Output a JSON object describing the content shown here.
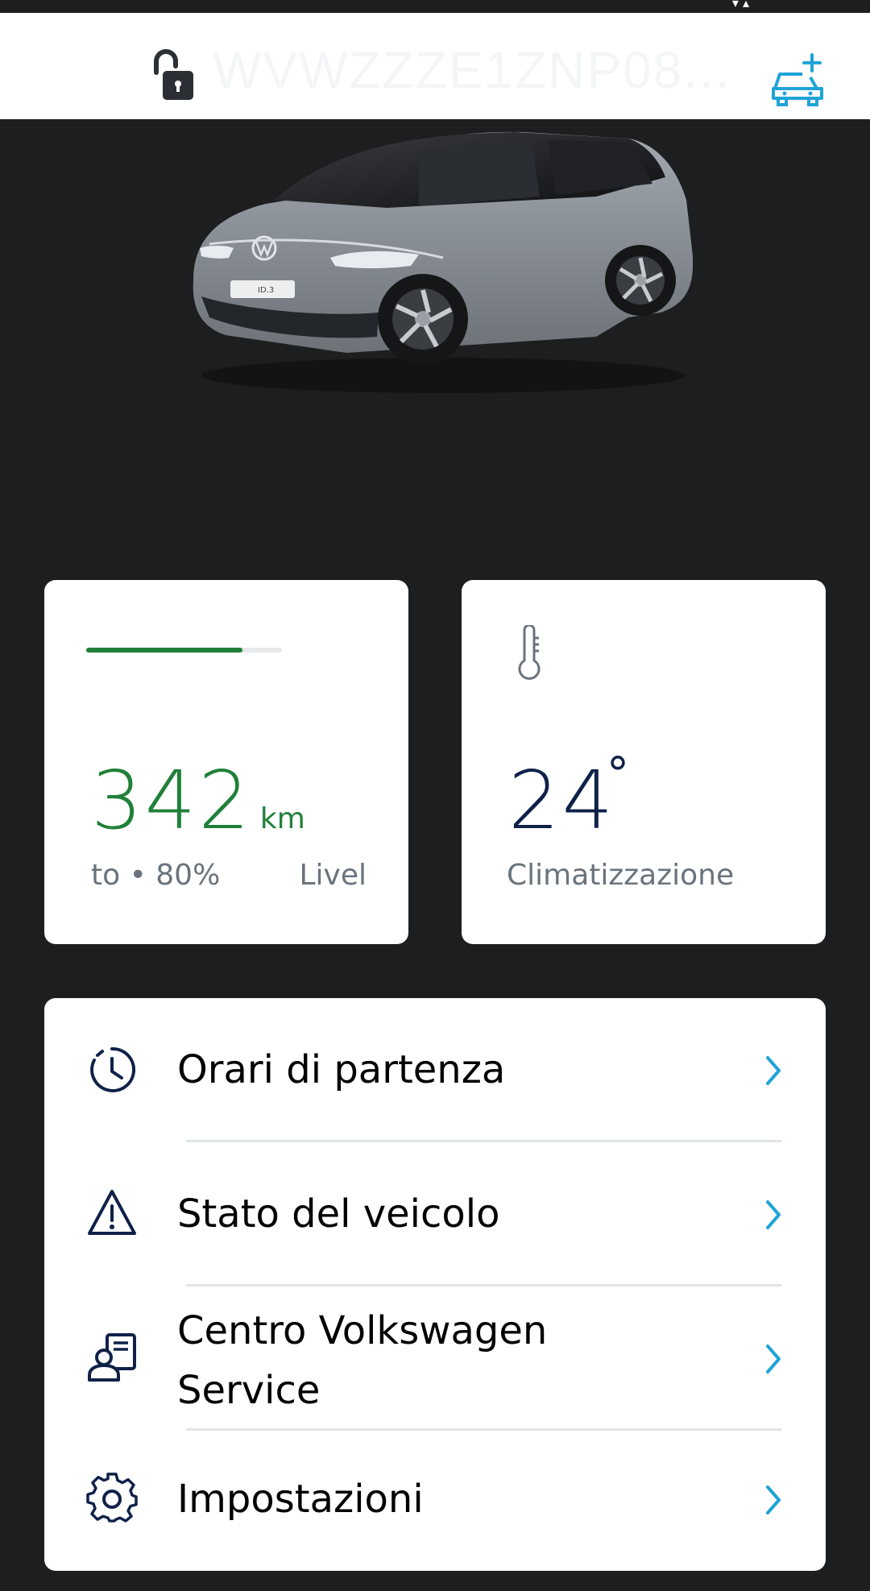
{
  "header": {
    "vin": "WVWZZZE1ZNP08..."
  },
  "colors": {
    "accent": "#1fa3d8",
    "range_green": "#208039",
    "navy": "#0f2149",
    "muted_text": "#6a737d",
    "background": "#1d1e20"
  },
  "icons": {
    "lock": "lock-open-icon",
    "add_vehicle": "add-vehicle-icon",
    "thermometer": "thermometer-icon",
    "clock": "clock-icon",
    "warning": "warning-icon",
    "service": "service-icon",
    "gear": "gear-icon",
    "chevron": "chevron-right-icon"
  },
  "range_card": {
    "value": "342",
    "unit": "km",
    "caption_left": "to • 80%",
    "caption_right": "Livel",
    "progress_fraction": 0.8
  },
  "climate_card": {
    "value": "24",
    "degree": "°",
    "caption": "Climatizzazione"
  },
  "menu": {
    "items": [
      {
        "label": "Orari di partenza"
      },
      {
        "label": "Stato del veicolo"
      },
      {
        "label": "Centro Volkswagen Service"
      },
      {
        "label": "Impostazioni"
      }
    ]
  }
}
